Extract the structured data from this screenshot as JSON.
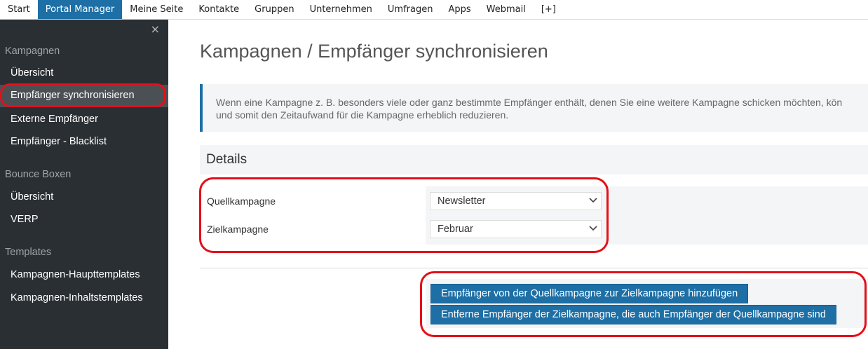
{
  "topnav": {
    "tabs": [
      {
        "label": "Start"
      },
      {
        "label": "Portal Manager",
        "active": true
      },
      {
        "label": "Meine Seite"
      },
      {
        "label": "Kontakte"
      },
      {
        "label": "Gruppen"
      },
      {
        "label": "Unternehmen"
      },
      {
        "label": "Umfragen"
      },
      {
        "label": "Apps"
      },
      {
        "label": "Webmail"
      },
      {
        "label": "[+]"
      }
    ]
  },
  "sidebar": {
    "close_icon": "×",
    "sections": [
      {
        "title": "Kampagnen",
        "items": [
          "Übersicht",
          "Empfänger synchronisieren",
          "Externe Empfänger",
          "Empfänger - Blacklist"
        ]
      },
      {
        "title": "Bounce Boxen",
        "items": [
          "Übersicht",
          "VERP"
        ]
      },
      {
        "title": "Templates",
        "items": [
          "Kampagnen-Haupttemplates",
          "Kampagnen-Inhaltstemplates"
        ]
      }
    ],
    "active_item": "Empfänger synchronisieren"
  },
  "main": {
    "title": "Kampagnen / Empfänger synchronisieren",
    "info_line1": "Wenn eine Kampagne z. B. besonders viele oder ganz bestimmte Empfänger enthält, denen Sie eine weitere Kampagne schicken möchten, kön",
    "info_line2": "und somit den Zeitaufwand für die Kampagne erheblich reduzieren.",
    "details_title": "Details",
    "source_label": "Quellkampagne",
    "source_value": "Newsletter",
    "target_label": "Zielkampagne",
    "target_value": "Februar",
    "add_button": "Empfänger von der Quellkampagne zur Zielkampagne hinzufügen",
    "remove_button": "Entferne Empfänger der Zielkampagne, die auch Empfänger der Quellkampagne sind"
  },
  "colors": {
    "accent": "#1d6fa5",
    "sidebar_bg": "#2a2f33",
    "highlight": "#e3101a"
  }
}
